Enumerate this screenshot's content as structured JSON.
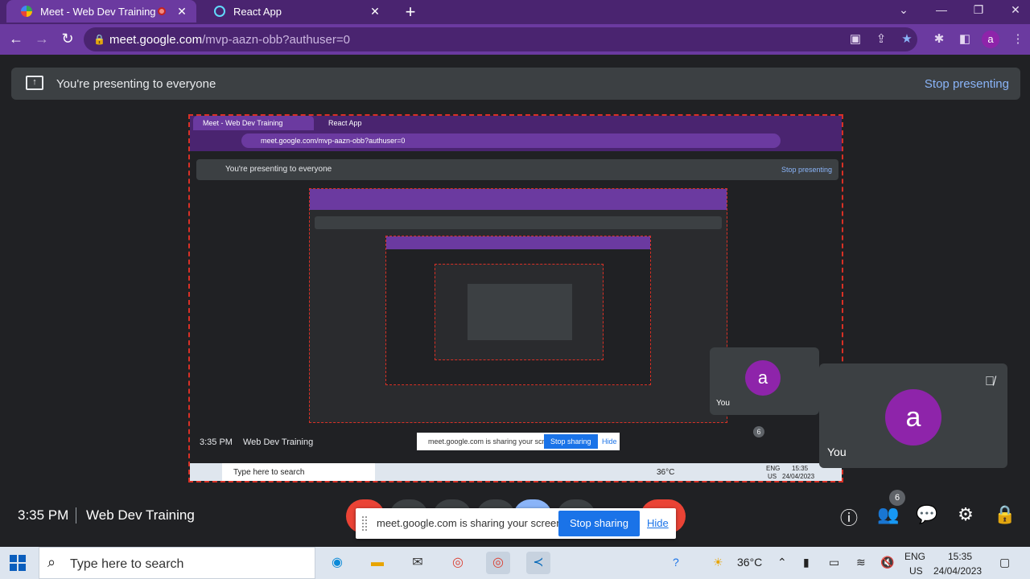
{
  "browser": {
    "tabs": [
      {
        "title": "Meet - Web Dev Training",
        "close": "✕"
      },
      {
        "title": "React App",
        "close": "✕"
      }
    ],
    "new_tab": "+",
    "window_controls": {
      "menu": "⌄",
      "minimize": "—",
      "restore": "❐",
      "close": "✕"
    },
    "nav": {
      "back": "←",
      "forward": "→",
      "reload": "↻"
    },
    "url_host": "meet.google.com",
    "url_path": "/mvp-aazn-obb?authuser=0",
    "profile_initial": "a",
    "toolbar_icons": [
      "camera-blocked-icon",
      "share-icon",
      "bookmark-star-icon",
      "extensions-icon",
      "sidebar-icon",
      "profile-avatar",
      "kebab-menu-icon"
    ]
  },
  "banner": {
    "text": "You're presenting to everyone",
    "stop_label": "Stop presenting"
  },
  "shared_screen": {
    "tab1": "Meet - Web Dev Training",
    "tab2": "React App",
    "url": "meet.google.com/mvp-aazn-obb?authuser=0",
    "banner_text": "You're presenting to everyone",
    "banner_stop": "Stop presenting",
    "time": "3:35 PM",
    "meeting": "Web Dev Training",
    "share_msg": "meet.google.com is sharing your screen.",
    "stop_sharing": "Stop sharing",
    "hide": "Hide",
    "participants": "6",
    "tile_initial": "a",
    "tile_you": "You",
    "taskbar_search": "Type here to search",
    "weather": "36°C",
    "lang": "ENG",
    "region": "US",
    "clock_time": "15:35",
    "clock_date": "24/04/2023"
  },
  "self_tile": {
    "initial": "a",
    "label": "You"
  },
  "footer": {
    "time": "3:35 PM",
    "meeting_name": "Web Dev Training",
    "participant_count": "6"
  },
  "share_bar": {
    "message": "meet.google.com is sharing your screen.",
    "stop_label": "Stop sharing",
    "hide_label": "Hide"
  },
  "taskbar": {
    "search_placeholder": "Type here to search",
    "weather": "36°C",
    "lang": "ENG",
    "region": "US",
    "time": "15:35",
    "date": "24/04/2023"
  },
  "colors": {
    "browser_frame": "#4a2470",
    "active_tab": "#6b3aa0",
    "meet_background": "#202124",
    "banner": "#3c4043",
    "link_blue": "#8ab4f8",
    "end_call_red": "#ea4335",
    "avatar_purple": "#8e24aa",
    "stop_sharing_blue": "#1a73e8"
  }
}
